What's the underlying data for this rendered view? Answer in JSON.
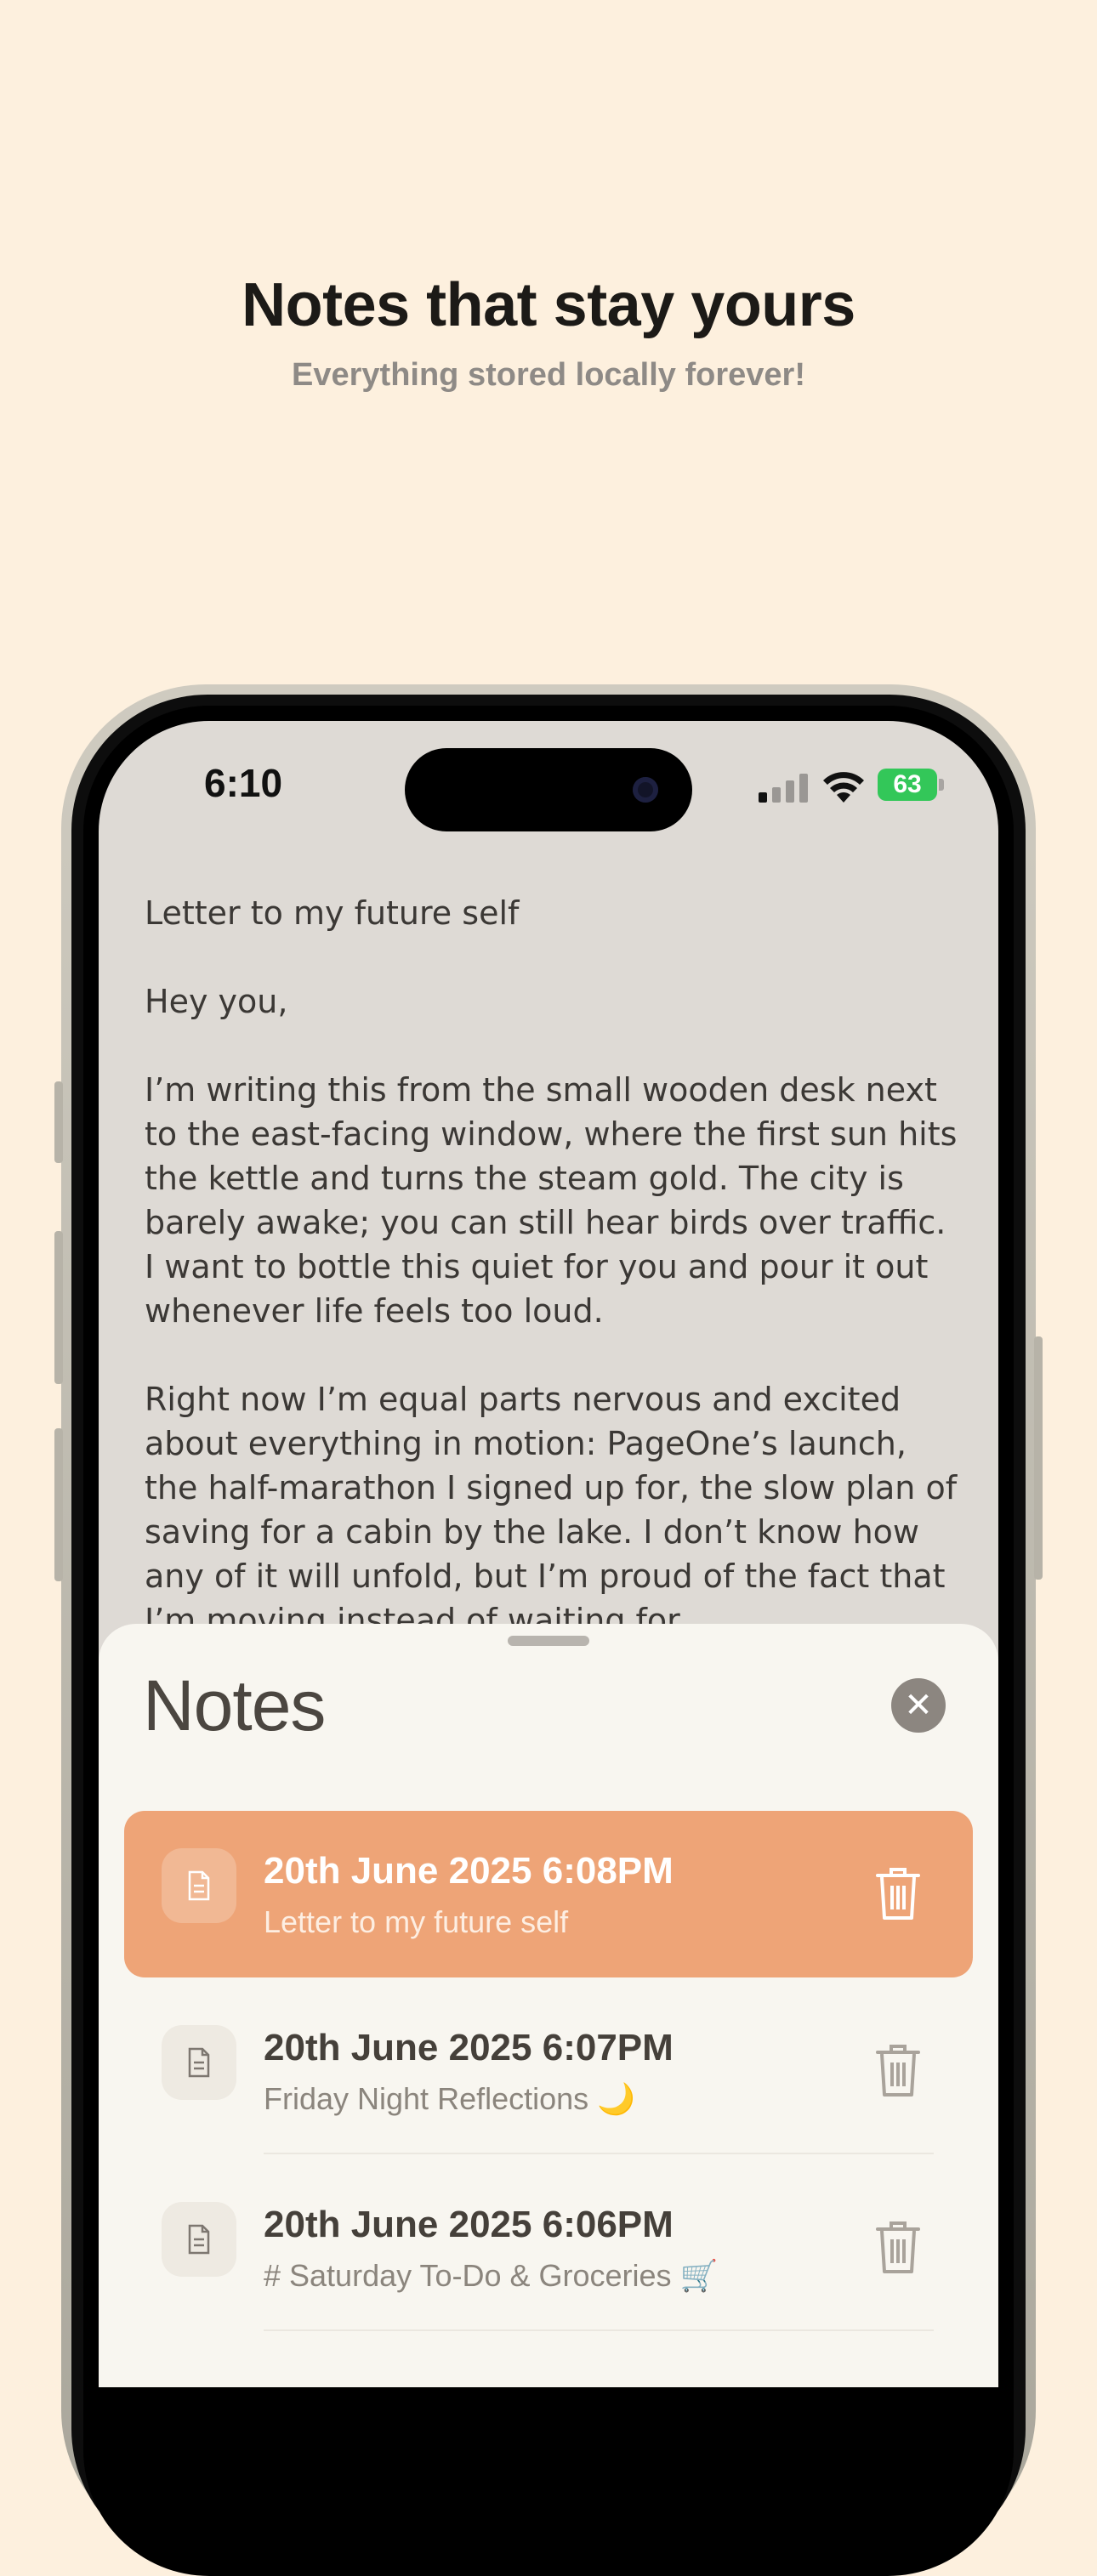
{
  "hero": {
    "title": "Notes that stay yours",
    "subtitle": "Everything stored locally forever!"
  },
  "status_bar": {
    "time": "6:10",
    "battery": "63"
  },
  "note": {
    "title": "Letter to my future self",
    "greeting": "Hey you,",
    "paragraph1": "I’m writing this from the small wooden desk next to the east-facing window, where the first sun hits the kettle and turns the steam gold. The city is barely awake; you can still hear birds over traffic. I want to bottle this quiet for you and pour it out whenever life feels too loud.",
    "paragraph2": "Right now I’m equal parts nervous and excited about everything in motion: PageOne’s launch, the half-marathon I signed up for, the slow plan of saving for a cabin by the lake. I don’t know how any of it will unfold, but I’m proud of the fact that I’m moving instead of waiting for"
  },
  "sheet": {
    "title": "Notes",
    "close_icon": "close-icon",
    "items": [
      {
        "date": "20th June 2025 6:08PM",
        "snippet": "Letter to my future self",
        "active": true
      },
      {
        "date": "20th June 2025 6:07PM",
        "snippet": "Friday Night Reflections 🌙",
        "active": false
      },
      {
        "date": "20th June 2025 6:06PM",
        "snippet": "# Saturday To-Do & Groceries 🛒",
        "active": false
      }
    ]
  },
  "colors": {
    "background": "#fdf0de",
    "accent": "#eea477",
    "sheet": "#f8f6f0"
  }
}
